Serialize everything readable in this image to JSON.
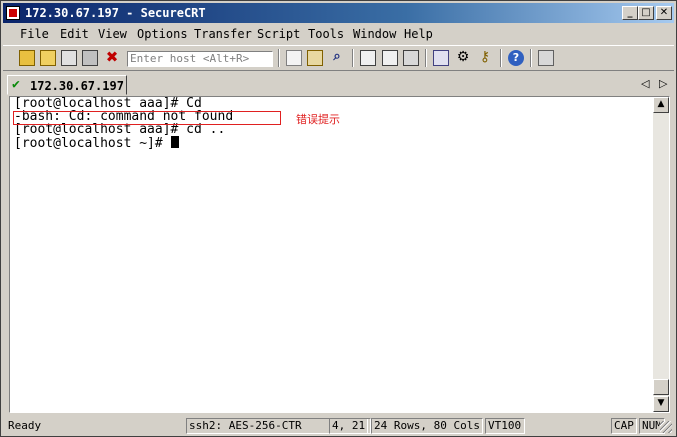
{
  "window": {
    "title": "172.30.67.197 - SecureCRT"
  },
  "title_buttons": [
    "_",
    "□",
    "✕"
  ],
  "menu": [
    "File",
    "Edit",
    "View",
    "Options",
    "Transfer",
    "Script",
    "Tools",
    "Window",
    "Help"
  ],
  "toolbar": {
    "host_placeholder": "Enter host <Alt+R>"
  },
  "tabs": [
    {
      "label": "172.30.67.197",
      "status": "connected"
    }
  ],
  "tab_nav": {
    "prev": "◁",
    "next": "▷"
  },
  "terminal": {
    "lines": [
      "[root@localhost aaa]# Cd",
      "-bash: Cd: command not found",
      "[root@localhost aaa]# cd ..",
      "[root@localhost ~]# "
    ],
    "annotation": "错误提示",
    "annotation_color": "#e02020"
  },
  "status": {
    "ready": "Ready",
    "cipher": "ssh2: AES-256-CTR",
    "position": "4,   21",
    "size": "24 Rows, 80 Cols",
    "terminal_type": "VT100",
    "caps": "CAP",
    "num": "NUM"
  }
}
